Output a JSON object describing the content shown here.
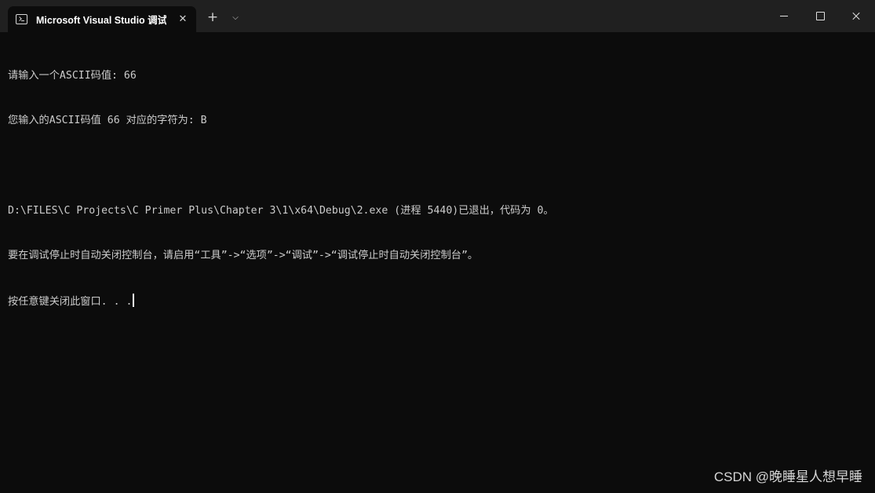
{
  "tab": {
    "icon": "terminal-icon",
    "title": "Microsoft Visual Studio 调试控制台",
    "close_icon": "close-icon",
    "close_label": "✕"
  },
  "tabbar": {
    "new_tab_icon": "plus-icon",
    "new_tab_label": "+",
    "dropdown_icon": "chevron-down-icon",
    "dropdown_label": "⌵"
  },
  "window_controls": {
    "minimize_icon": "minimize-icon",
    "maximize_icon": "maximize-icon",
    "close_icon": "close-icon"
  },
  "console": {
    "lines": [
      "请输入一个ASCII码值: 66",
      "您输入的ASCII码值 66 对应的字符为: B",
      "",
      "D:\\FILES\\C Projects\\C Primer Plus\\Chapter 3\\1\\x64\\Debug\\2.exe (进程 5440)已退出，代码为 0。",
      "要在调试停止时自动关闭控制台，请启用“工具”->“选项”->“调试”->“调试停止时自动关闭控制台”。",
      "按任意键关闭此窗口. . ."
    ]
  },
  "watermark": "CSDN @晚睡星人想早睡",
  "colors": {
    "console_background": "#0c0c0c",
    "titlebar_background": "#202020",
    "console_text": "#cccccc"
  }
}
